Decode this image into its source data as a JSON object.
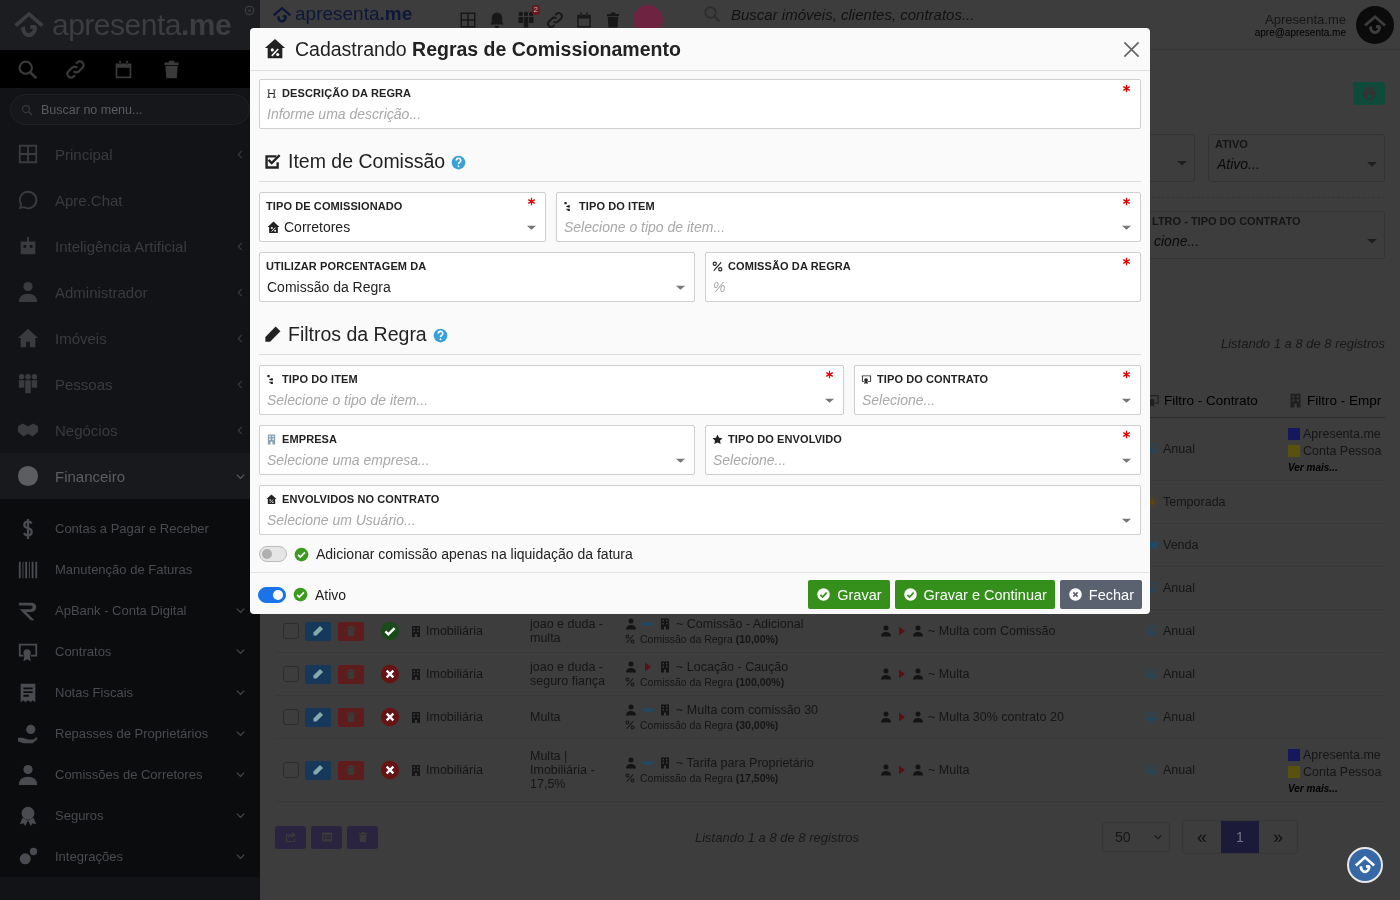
{
  "sidebar": {
    "logo": "apresenta**.me**",
    "search": {
      "placeholder": "Buscar no menu..."
    },
    "items": [
      {
        "label": "Principal",
        "selected": false,
        "expanded": false
      },
      {
        "label": "Apre.Chat",
        "selected": false
      },
      {
        "label": "Inteligência Artificial",
        "selected": false,
        "expanded": false
      },
      {
        "label": "Administrador",
        "selected": false,
        "expanded": false
      },
      {
        "label": "Imóveis",
        "selected": false,
        "expanded": false
      },
      {
        "label": "Pessoas",
        "selected": false,
        "expanded": false
      },
      {
        "label": "Negócios",
        "selected": false,
        "expanded": false
      },
      {
        "label": "Financeiro",
        "selected": true,
        "expanded": true,
        "children": [
          {
            "label": "Contas a Pagar e Receber",
            "selected": false
          },
          {
            "label": "Manutenção de Faturas",
            "selected": false
          },
          {
            "label": "ApBank - Conta Digital",
            "selected": false,
            "expanded": false
          },
          {
            "label": "Contratos",
            "selected": false,
            "expanded": false
          },
          {
            "label": "Notas Fiscais",
            "selected": false,
            "expanded": false
          },
          {
            "label": "Repasses de Proprietários",
            "selected": false,
            "expanded": false
          },
          {
            "label": "Comissões de Corretores",
            "selected": false,
            "expanded": false
          },
          {
            "label": "Seguros",
            "selected": false,
            "expanded": false
          },
          {
            "label": "Integrações",
            "selected": false,
            "expanded": false
          }
        ]
      }
    ]
  },
  "topbar": {
    "logo": "apresenta**.me**",
    "notification_count": "2",
    "search": {
      "placeholder": "Buscar imóveis, clientes, contratos..."
    },
    "user": {
      "name": "Apresenta.me",
      "email": "apre@apresenta.me"
    }
  },
  "filters": {
    "fields": [
      {
        "label": "ATIVO",
        "placeholder": "Ativo..."
      },
      {
        "label": "LTRO - TIPO DO CONTRATO",
        "placeholder": "cione..."
      }
    ]
  },
  "listing_top": "Listando 1 a 8 de 8 registros",
  "table": {
    "columns": [
      "Filtro - Contrato",
      "Filtro - Empr"
    ],
    "rows": [
      {
        "contract": {
          "label": "Anual",
          "kind": "annual"
        },
        "companies": [
          {
            "name": "Apresenta.me",
            "color": "#15185c"
          },
          {
            "name": "Conta Pessoa",
            "color": "#57530f"
          }
        ],
        "more": "Ver mais..."
      },
      {
        "contract": {
          "label": "Temporada",
          "kind": "season"
        }
      },
      {
        "contract": {
          "label": "Venda",
          "kind": "sale"
        }
      },
      {
        "contract": {
          "label": "Anual",
          "kind": "annual"
        }
      },
      {
        "checked": false,
        "active": true,
        "company": "Imobiliária",
        "description": "joao e duda - multa",
        "item": {
          "kind": "dash",
          "name": "~ Comissão - Adicional",
          "rate": "Comissão da Regra **(10,00%)**"
        },
        "involved": "~ Multa com Comissão",
        "contract": {
          "label": "Anual",
          "kind": "annual"
        }
      },
      {
        "checked": false,
        "active": false,
        "company": "Imobiliária",
        "description": "joao e duda - seguro fiança",
        "item": {
          "kind": "arrow",
          "name": "~ Locação - Caução",
          "rate": "Comissão da Regra **(100,00%)**"
        },
        "involved": "~ Multa",
        "contract": {
          "label": "Anual",
          "kind": "annual"
        }
      },
      {
        "checked": false,
        "active": false,
        "company": "Imobiliária",
        "description": "Multa",
        "item": {
          "kind": "dash",
          "name": "~ Multa com comissão 30",
          "rate": "Comissão da Regra **(30,00%)**"
        },
        "involved": "~ Multa 30% contrato 20",
        "contract": {
          "label": "Anual",
          "kind": "annual"
        }
      },
      {
        "checked": false,
        "active": false,
        "company": "Imobiliária",
        "description": "Multa | Imobiliária - 17,5%",
        "item": {
          "kind": "dash",
          "name": "~ Tarifa para Proprietário",
          "rate": "Comissão da Regra **(17,50%)**"
        },
        "involved": "~ Multa",
        "contract": {
          "label": "Anual",
          "kind": "annual"
        },
        "companies": [
          {
            "name": "Apresenta.me",
            "color": "#15185c"
          },
          {
            "name": "Conta Pessoa",
            "color": "#57530f"
          }
        ],
        "more": "Ver mais..."
      }
    ]
  },
  "footer": {
    "listing": "Listando 1 a 8 de 8 registros",
    "page_size": "50",
    "prev": "«",
    "next": "»",
    "pages": [
      {
        "label": "1",
        "selected": true
      }
    ]
  },
  "modal": {
    "title": "Cadastrando **Regras de Comissionamento**",
    "description_field": {
      "label": "DESCRIÇÃO DA REGRA",
      "required": true,
      "placeholder": "Informe uma descrição..."
    },
    "sections": [
      {
        "title": "Item de Comissão",
        "rows": [
          {
            "fields": [
              {
                "kind": "select",
                "label": "TIPO DE COMISSIONADO",
                "required": true,
                "value": "Corretores"
              },
              {
                "kind": "select",
                "label": "TIPO DO ITEM",
                "required": true,
                "placeholder": "Selecione o tipo de item..."
              }
            ]
          },
          {
            "fields": [
              {
                "kind": "select",
                "label": "UTILIZAR PORCENTAGEM DA",
                "required": false,
                "value": "Comissão da Regra"
              },
              {
                "kind": "text",
                "label": "COMISSÃO DA REGRA",
                "required": true,
                "placeholder": "%"
              }
            ]
          }
        ]
      },
      {
        "title": "Filtros da Regra",
        "rows": [
          {
            "fields": [
              {
                "kind": "select",
                "label": "TIPO DO ITEM",
                "required": true,
                "placeholder": "Selecione o tipo de item..."
              },
              {
                "kind": "select",
                "label": "TIPO DO CONTRATO",
                "required": true,
                "placeholder": "Selecione..."
              }
            ]
          },
          {
            "fields": [
              {
                "kind": "select",
                "label": "EMPRESA",
                "required": false,
                "placeholder": "Selecione uma empresa..."
              },
              {
                "kind": "select",
                "label": "TIPO DO ENVOLVIDO",
                "required": true,
                "placeholder": "Selecione..."
              }
            ]
          },
          {
            "fields": [
              {
                "kind": "select",
                "label": "ENVOLVIDOS NO CONTRATO",
                "required": false,
                "placeholder": "Selecione um Usuário..."
              }
            ]
          }
        ]
      }
    ],
    "switches": [
      {
        "label": "Adicionar comissão apenas na liquidação da fatura",
        "on": false
      }
    ],
    "active": {
      "label": "Ativo",
      "on": true
    },
    "buttons": [
      {
        "label": "Gravar",
        "kind": "save"
      },
      {
        "label": "Gravar e Continuar",
        "kind": "save"
      },
      {
        "label": "Fechar",
        "kind": "close"
      }
    ]
  }
}
